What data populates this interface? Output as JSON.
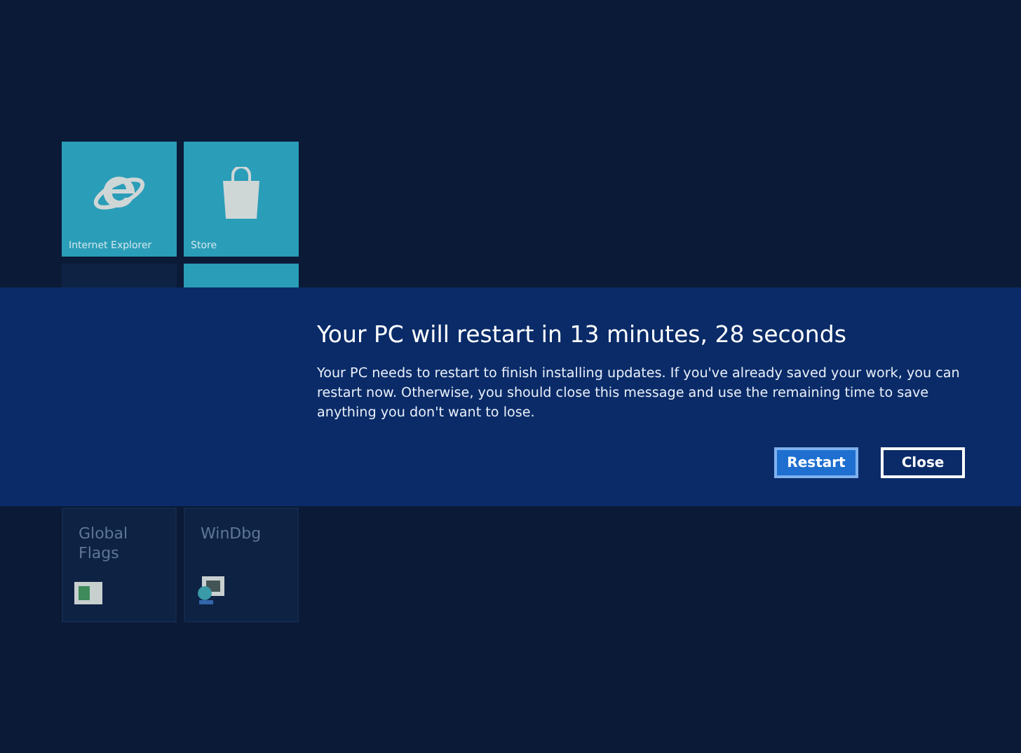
{
  "start_tiles": [
    {
      "label": "Internet Explorer",
      "kind": "browser"
    },
    {
      "label": "Store",
      "kind": "store"
    },
    {
      "kind": "blank"
    },
    {
      "kind": "blank"
    }
  ],
  "lower_tiles": [
    {
      "label": "Global Flags",
      "kind": "flags"
    },
    {
      "label": "WinDbg",
      "kind": "debugger"
    }
  ],
  "dialog": {
    "title": "Your PC will restart in 13 minutes, 28 seconds",
    "message": "Your PC needs to restart to finish installing updates. If you've already saved your work, you can restart now. Otherwise, you should close this message and use the remaining time to save anything you don't want to lose.",
    "buttons": [
      {
        "label": "Restart",
        "primary": true
      },
      {
        "label": "Close",
        "primary": false
      }
    ]
  }
}
